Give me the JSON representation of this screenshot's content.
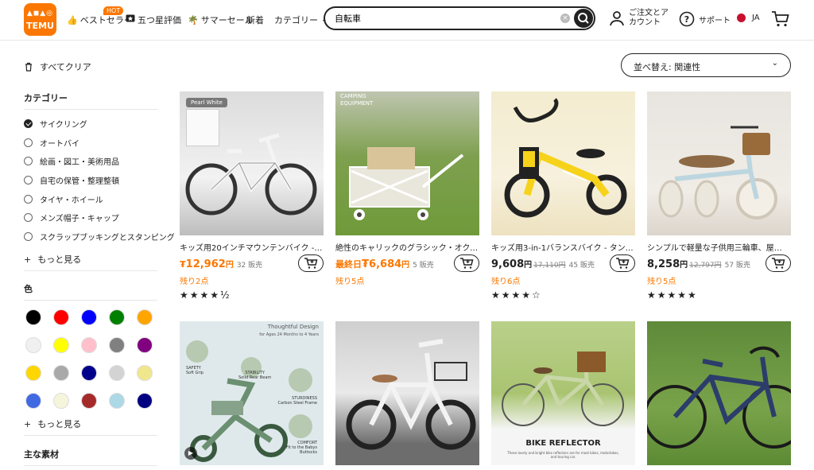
{
  "header": {
    "logo": "TEMU",
    "nav": {
      "bestseller": "ベストセラー",
      "hot_badge": "HOT",
      "five_star": "五つ星評価",
      "summer_sale": "サマーセール",
      "new": "新着",
      "category": "カテゴリー"
    },
    "search": {
      "value": "自転車"
    },
    "account": {
      "line1": "ご注文とア",
      "line2": "カウント"
    },
    "support": "サポート",
    "language": "JA"
  },
  "sidebar": {
    "clear_all": "すべてクリア",
    "category_title": "カテゴリー",
    "categories": [
      {
        "label": "サイクリング",
        "checked": true
      },
      {
        "label": "オートバイ",
        "checked": false
      },
      {
        "label": "絵画・図工・美術用品",
        "checked": false
      },
      {
        "label": "自宅の保管・整理整頓",
        "checked": false
      },
      {
        "label": "タイヤ・ホイール",
        "checked": false
      },
      {
        "label": "メンズ帽子・キャップ",
        "checked": false
      },
      {
        "label": "スクラップブッキングとスタンピング",
        "checked": false
      }
    ],
    "more1": "もっと見る",
    "color_title": "色",
    "colors": [
      "#000000",
      "#ff0000",
      "#0000ff",
      "#008000",
      "#ffa500",
      "#f0f0f0",
      "#ffff00",
      "#ffc0cb",
      "#808080",
      "#800080",
      "#ffd700",
      "#a9a9a9",
      "#00008b",
      "#d3d3d3",
      "#f0e68c",
      "#4169e1",
      "#f5f5dc",
      "#a52a2a",
      "#add8e6",
      "#000080"
    ],
    "more2": "もっと見る",
    "material_title": "主な素材"
  },
  "sort": {
    "label": "並べ替え: 関連性"
  },
  "products": [
    {
      "title": "キッズ用20インチマウンテンバイク - 耐…",
      "price_prefix": "₮",
      "price": "12,962",
      "unit": "円",
      "old_price": "",
      "sold": "32 販売",
      "stock": "残り2点",
      "stars": "★★★★½",
      "orange": true
    },
    {
      "title": "絶性のキャリックのグラシック・オクスフ…",
      "price_prefix": "最終日",
      "price": "₮6,684",
      "unit": "円",
      "old_price": "",
      "sold": "5 販売",
      "stock": "残り5点",
      "stars": "",
      "orange": true
    },
    {
      "title": "キッズ用3-in-1バランスバイク - タング…",
      "price_prefix": "",
      "price": "9,608",
      "unit": "円",
      "old_price": "17,110円",
      "sold": "45 販売",
      "stock": "残り6点",
      "stars": "★★★★☆",
      "orange": false
    },
    {
      "title": "シンプルで軽量な子供用三輪車、屋…",
      "price_prefix": "",
      "price": "8,258",
      "unit": "円",
      "old_price": "12,797円",
      "sold": "57 販売",
      "stock": "残り5点",
      "stars": "★★★★★",
      "orange": false
    }
  ],
  "row2_texts": {
    "thoughtful": "Thoughtful Design",
    "ages": "for Ages 24 Months to 4 Years",
    "safety": "SAFETY",
    "soft_grip": "Soft Grip",
    "stability": "STABILITY",
    "solid_rear": "Solid Rear Beam",
    "sturdiness": "STURDINESS",
    "carbon": "Carbon Steel Frame",
    "comfort": "COMFORT",
    "fit": "Fit to the Babys",
    "buttocks": "Buttocks",
    "reflector": "BIKE REFLECTOR",
    "reflector_sub": "These lovely and bright bike reflectors are for most bikes, motorbikes,",
    "reflector_sub2": "and touring car."
  },
  "image_texts": {
    "pearl_white": "Pearl White",
    "camping": "CAMPING",
    "equipment": "EQUIPMENT"
  }
}
